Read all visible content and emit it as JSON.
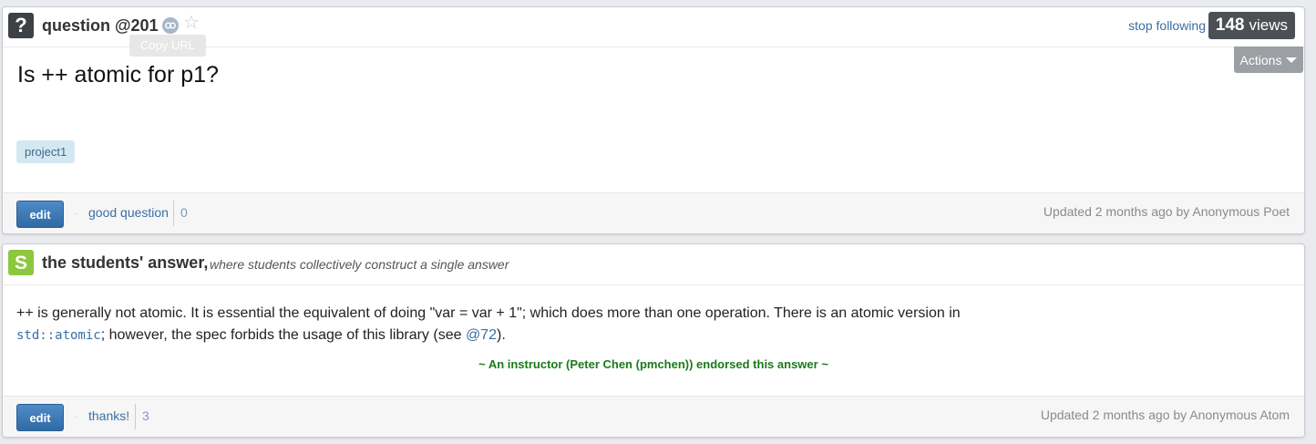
{
  "question": {
    "title": "question @201",
    "tooltip": "Copy URL",
    "stop_following": "stop following",
    "views_count": "148",
    "views_label": "views",
    "actions_label": "Actions",
    "text": "Is ++ atomic for p1?",
    "tag": "project1",
    "edit_label": "edit",
    "good_question_label": "good question",
    "good_question_count": "0",
    "updated": "Updated 2 months ago by Anonymous Poet"
  },
  "answer": {
    "title": "the students' answer,",
    "subtitle": "where students collectively construct a single answer",
    "body_line1": "++ is generally not atomic. It is essential the equivalent of doing \"var = var + 1\"; which does more than one operation. There is an atomic version in",
    "code": "std::atomic",
    "body_line2_a": ";  however, the spec forbids the usage of this library (see ",
    "ref": "@72",
    "body_line2_b": ").",
    "endorsement": "~ An instructor (Peter Chen (pmchen)) endorsed this answer  ~",
    "edit_label": "edit",
    "thanks_label": "thanks!",
    "thanks_count": "3",
    "updated": "Updated 2 months ago by Anonymous Atom"
  },
  "icons": {
    "question": "?",
    "students": "S",
    "star": "☆"
  },
  "colors": {
    "link": "#3a6fa5",
    "edit_button": "#3b77b4",
    "endorsed_text": "#1a7a1a",
    "students_icon": "#8dc63f"
  }
}
